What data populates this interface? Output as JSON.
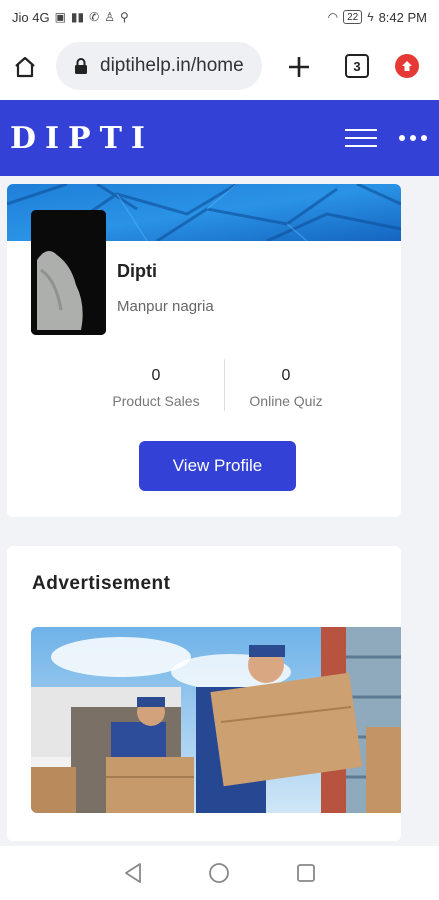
{
  "status_bar": {
    "carrier": "Jio 4G",
    "battery": "22",
    "time": "8:42 PM"
  },
  "browser": {
    "url": "diptihelp.in/home",
    "tab_count": "3",
    "icons": [
      "home-icon",
      "lock-icon",
      "plus-icon",
      "tabs-icon",
      "notification-icon"
    ]
  },
  "site": {
    "logo": "DIPTI",
    "accent_color": "#3341d6",
    "icons": [
      "hamburger-icon",
      "more-icon"
    ]
  },
  "profile": {
    "name": "Dipti",
    "location": "Manpur nagria",
    "stats": [
      {
        "value": "0",
        "label": "Product Sales"
      },
      {
        "value": "0",
        "label": "Online Quiz"
      }
    ],
    "button_label": "View Profile"
  },
  "advertisement": {
    "title": "Advertisement"
  },
  "android_nav": {
    "icons": [
      "back-icon",
      "home-circle-icon",
      "recents-icon"
    ]
  }
}
